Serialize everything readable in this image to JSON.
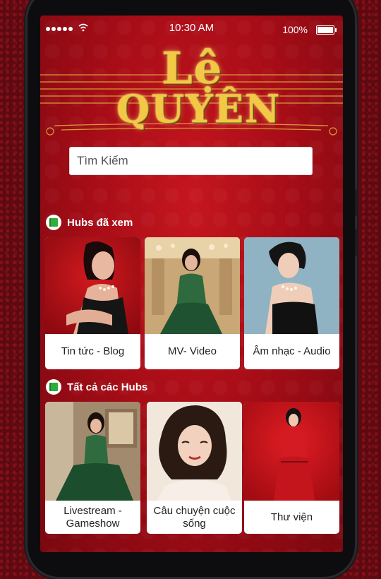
{
  "status": {
    "time": "10:30 AM",
    "battery": "100%",
    "battery_level": 1.0
  },
  "brand": {
    "logo_top": "Lệ",
    "logo_bottom": "QUYÊN"
  },
  "search": {
    "placeholder": "Tìm Kiếm"
  },
  "sections": [
    {
      "title": "Hubs đã xem",
      "cards": [
        {
          "label": "Tin tức - Blog"
        },
        {
          "label": "MV- Video"
        },
        {
          "label": "Âm nhạc - Audio"
        }
      ]
    },
    {
      "title": "Tất cả các Hubs",
      "cards": [
        {
          "label": "Livestream - Gameshow"
        },
        {
          "label": "Câu chuyện cuộc sống"
        },
        {
          "label": "Thư viện"
        }
      ]
    }
  ],
  "colors": {
    "accent": "#c5161f",
    "gold": "#f2c845",
    "book_icon": "#2fae3a"
  }
}
